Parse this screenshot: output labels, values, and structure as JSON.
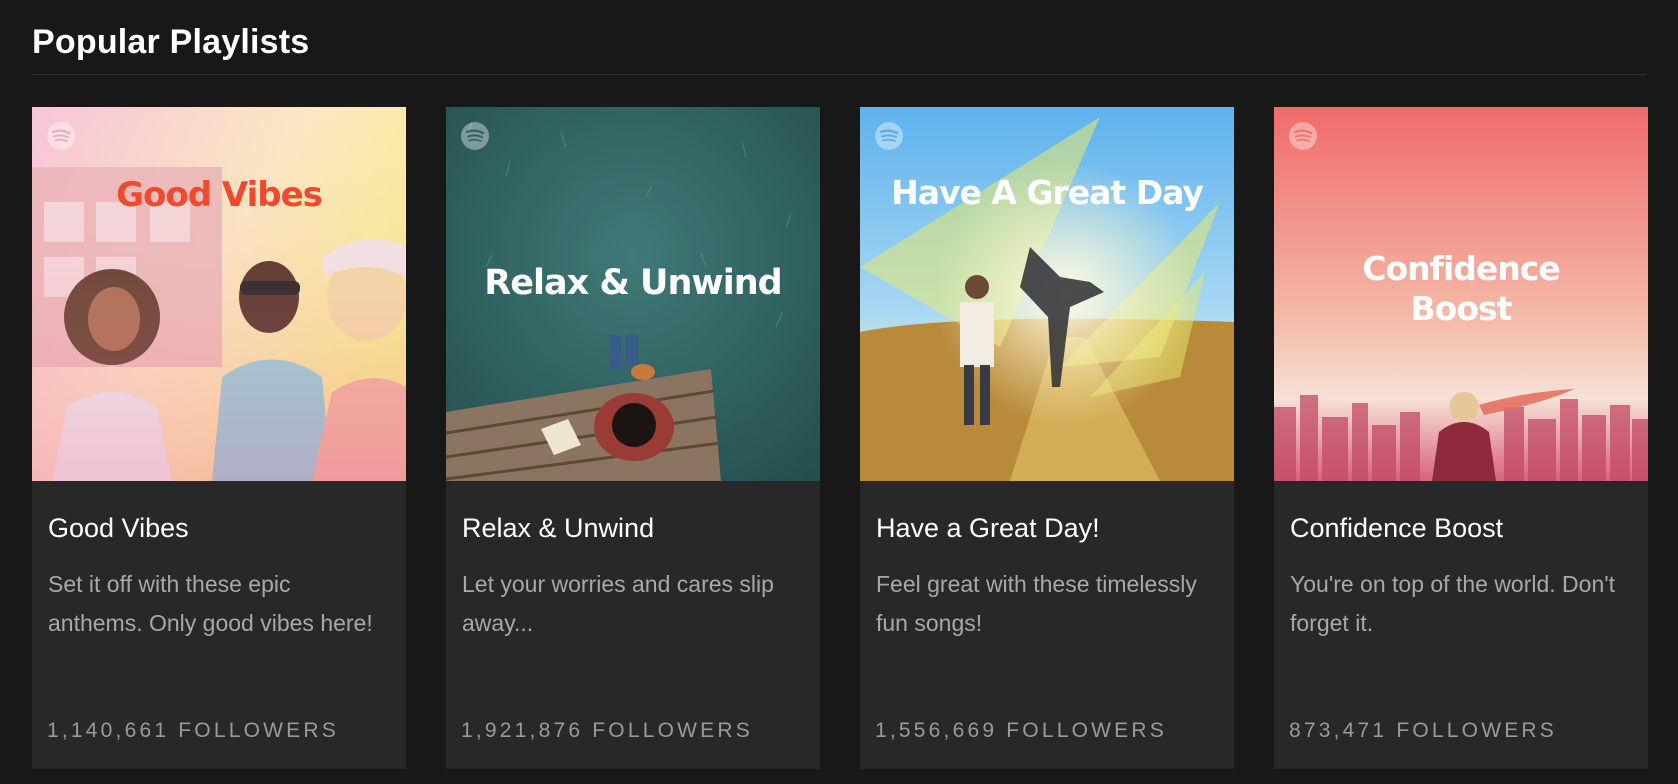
{
  "section": {
    "title": "Popular Playlists"
  },
  "playlists": [
    {
      "cover_text": "Good Vibes",
      "title": "Good Vibes",
      "description": "Set it off with these epic anthems. Only good vibes here!",
      "followers": "1,140,661 FOLLOWERS"
    },
    {
      "cover_text": "Relax & Unwind",
      "title": "Relax & Unwind",
      "description": "Let your worries and cares slip away...",
      "followers": "1,921,876 FOLLOWERS"
    },
    {
      "cover_text": "Have A Great Day",
      "title": "Have a Great Day!",
      "description": "Feel great with these timelessly fun songs!",
      "followers": "1,556,669 FOLLOWERS"
    },
    {
      "cover_text": "Confidence\nBoost",
      "title": "Confidence Boost",
      "description": "You're on top of the world. Don't forget it.",
      "followers": "873,471 FOLLOWERS"
    }
  ],
  "icons": {
    "cover_logo": "spotify-logo-icon"
  },
  "colors": {
    "background": "#181818",
    "card": "#282828",
    "good_vibes_text": "#f04a2e",
    "description": "#a8a8a8"
  }
}
